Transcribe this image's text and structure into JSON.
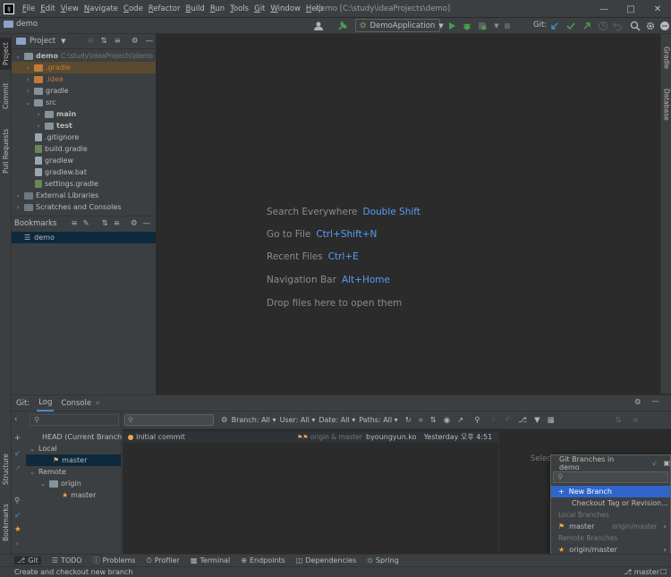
{
  "menubar": {
    "logo": "IJ",
    "items": [
      "File",
      "Edit",
      "View",
      "Navigate",
      "Code",
      "Refactor",
      "Build",
      "Run",
      "Tools",
      "Git",
      "Window",
      "Help"
    ],
    "window_title": "demo [C:\\study\\ideaProjects\\demo]"
  },
  "toolbar": {
    "project_crumb": "demo",
    "run_config": "DemoApplication",
    "git_label": "Git:"
  },
  "left_strip": {
    "tabs": [
      "Project",
      "Commit",
      "Pull Requests",
      "Structure",
      "Bookmarks"
    ]
  },
  "right_strip": {
    "tabs": [
      "Gradle",
      "Database"
    ]
  },
  "project": {
    "header": "Project",
    "root_name": "demo",
    "root_path": "C:\\study\\ideaProjects\\demo",
    "items": [
      {
        "label": ".gradle"
      },
      {
        "label": ".idea"
      },
      {
        "label": "gradle"
      },
      {
        "label": "src"
      },
      {
        "label": "main"
      },
      {
        "label": "test"
      },
      {
        "label": ".gitignore"
      },
      {
        "label": "build.gradle"
      },
      {
        "label": "gradlew"
      },
      {
        "label": "gradlew.bat"
      },
      {
        "label": "settings.gradle"
      },
      {
        "label": "External Libraries"
      },
      {
        "label": "Scratches and Consoles"
      }
    ]
  },
  "bookmarks": {
    "header": "Bookmarks",
    "items": [
      "demo"
    ]
  },
  "editor": {
    "hints": [
      {
        "action": "Search Everywhere",
        "key": "Double Shift"
      },
      {
        "action": "Go to File",
        "key": "Ctrl+Shift+N"
      },
      {
        "action": "Recent Files",
        "key": "Ctrl+E"
      },
      {
        "action": "Navigation Bar",
        "key": "Alt+Home"
      },
      {
        "action": "Drop files here to open them",
        "key": ""
      }
    ]
  },
  "git_panel": {
    "prefix": "Git:",
    "tabs": [
      "Log",
      "Console"
    ],
    "branch_tree": {
      "head": "HEAD (Current Branch)",
      "local": "Local",
      "local_master": "master",
      "remote": "Remote",
      "origin": "origin",
      "origin_master": "master"
    },
    "filters": [
      "Branch: All",
      "User: All",
      "Date: All",
      "Paths: All"
    ],
    "commit": {
      "message": "Initial commit",
      "refs": "origin & master",
      "author": "byoungyun.ko",
      "date": "Yesterday 오후 4:51"
    },
    "details_hint": "Select"
  },
  "branch_popup": {
    "title": "Git Branches in demo",
    "new_branch": "New Branch",
    "checkout": "Checkout Tag or Revision...",
    "local_header": "Local Branches",
    "local_branch": "master",
    "local_tracking": "origin/master",
    "remote_header": "Remote Branches",
    "remote_branch": "origin/master"
  },
  "bottom_tools": {
    "items": [
      "Git",
      "TODO",
      "Problems",
      "Profiler",
      "Terminal",
      "Endpoints",
      "Dependencies",
      "Spring"
    ]
  },
  "status": {
    "message": "Create and checkout new branch",
    "branch": "master"
  },
  "colors": {
    "accent": "#589df6",
    "selection": "#2f65ca",
    "run_green": "#499c54",
    "orange_folder": "#c07b3a"
  }
}
